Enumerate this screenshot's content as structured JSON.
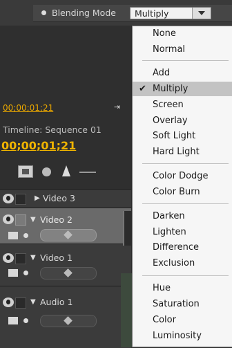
{
  "blending": {
    "label": "Blending Mode",
    "selected": "Multiply"
  },
  "timeline": {
    "timecode_top": "00;00;01;21",
    "timecode_top_glyph": "⇥",
    "title": "Timeline: Sequence 01",
    "timecode_main": "00;00;01;21"
  },
  "tracks": [
    {
      "name": "Video 3"
    },
    {
      "name": "Video 2"
    },
    {
      "name": "Video 1"
    },
    {
      "name": "Audio 1"
    }
  ],
  "menu": {
    "groups": [
      [
        "None",
        "Normal"
      ],
      [
        "Add",
        "Multiply",
        "Screen",
        "Overlay",
        "Soft Light",
        "Hard Light"
      ],
      [
        "Color Dodge",
        "Color Burn"
      ],
      [
        "Darken",
        "Lighten",
        "Difference",
        "Exclusion"
      ],
      [
        "Hue",
        "Saturation",
        "Color",
        "Luminosity"
      ]
    ],
    "checked_item": "Multiply"
  }
}
